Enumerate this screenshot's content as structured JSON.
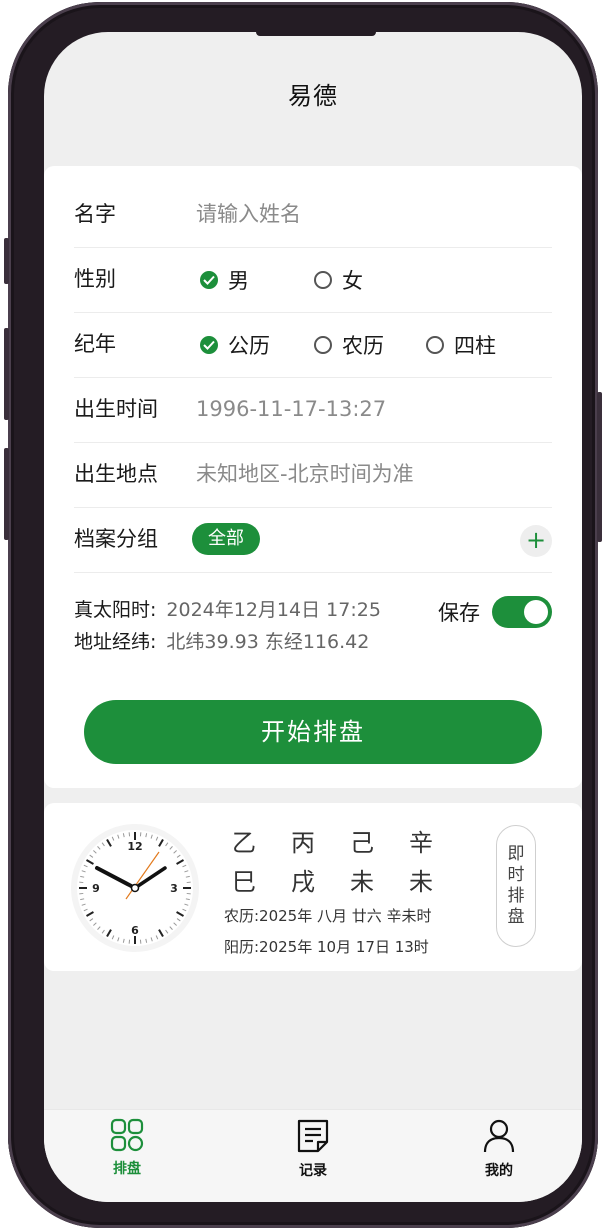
{
  "header": {
    "title": "易德"
  },
  "form": {
    "name_label": "名字",
    "name_placeholder": "请输入姓名",
    "gender_label": "性别",
    "gender_options": [
      "男",
      "女"
    ],
    "gender_selected": "男",
    "calendar_label": "纪年",
    "calendar_options": [
      "公历",
      "农历",
      "四柱"
    ],
    "calendar_selected": "公历",
    "birth_time_label": "出生时间",
    "birth_time_value": "1996-11-17-13:27",
    "birth_place_label": "出生地点",
    "birth_place_value": "未知地区-北京时间为准",
    "group_label": "档案分组",
    "group_chip": "全部",
    "add_group": "+",
    "true_solar_label": "真太阳时:",
    "true_solar_value": "2024年12月14日  17:25",
    "coords_label": "地址经纬:",
    "coords_value": "北纬39.93 东经116.42",
    "save_label": "保存",
    "save_on": true,
    "start_button": "开始排盘"
  },
  "clock_card": {
    "clock_numbers": [
      "12",
      "3",
      "6",
      "9"
    ],
    "stems": [
      "乙",
      "丙",
      "己",
      "辛"
    ],
    "branches": [
      "巳",
      "戌",
      "未",
      "未"
    ],
    "lunar_line": "农历:2025年 八月 廿六 辛未时",
    "solar_line": "阳历:2025年 10月 17日 13时",
    "instant_button": [
      "即",
      "时",
      "排",
      "盘"
    ]
  },
  "tabbar": {
    "items": [
      {
        "label": "排盘",
        "icon": "grid-icon",
        "active": true
      },
      {
        "label": "记录",
        "icon": "document-icon",
        "active": false
      },
      {
        "label": "我的",
        "icon": "person-icon",
        "active": false
      }
    ]
  },
  "colors": {
    "accent": "#1d8f3b",
    "background": "#efefef",
    "card": "#ffffff"
  }
}
